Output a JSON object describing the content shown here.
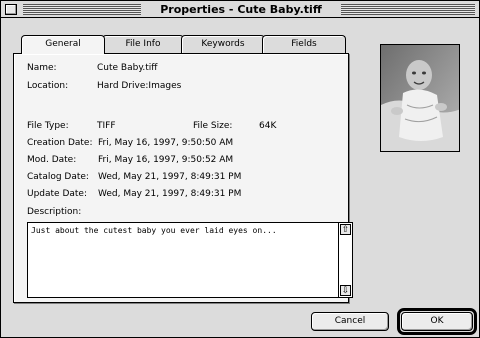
{
  "window": {
    "title": "Properties - Cute Baby.tiff"
  },
  "tabs": [
    {
      "label": "General",
      "active": true
    },
    {
      "label": "File Info",
      "active": false
    },
    {
      "label": "Keywords",
      "active": false
    },
    {
      "label": "Fields",
      "active": false
    }
  ],
  "fields": {
    "name_label": "Name:",
    "name_value": "Cute Baby.tiff",
    "location_label": "Location:",
    "location_value": "Hard Drive:Images",
    "filetype_label": "File Type:",
    "filetype_value": "TIFF",
    "filesize_label": "File Size:",
    "filesize_value": "64K",
    "creation_label": "Creation Date:",
    "creation_value": "Fri, May 16, 1997, 9:50:50 AM",
    "mod_label": "Mod. Date:",
    "mod_value": "Fri, May 16, 1997, 9:50:52 AM",
    "catalog_label": "Catalog Date:",
    "catalog_value": "Wed, May 21, 1997, 8:49:31 PM",
    "update_label": "Update Date:",
    "update_value": "Wed, May 21, 1997, 8:49:31 PM",
    "description_label": "Description:",
    "description_value": "Just about the cutest baby you ever laid eyes on..."
  },
  "icons": {
    "close": "close-box-icon",
    "scroll_up": "scroll-up-arrow-icon",
    "scroll_down": "scroll-down-arrow-icon"
  },
  "glyphs": {
    "up": "⇧",
    "down": "⇩"
  },
  "buttons": {
    "cancel": "Cancel",
    "ok": "OK"
  }
}
